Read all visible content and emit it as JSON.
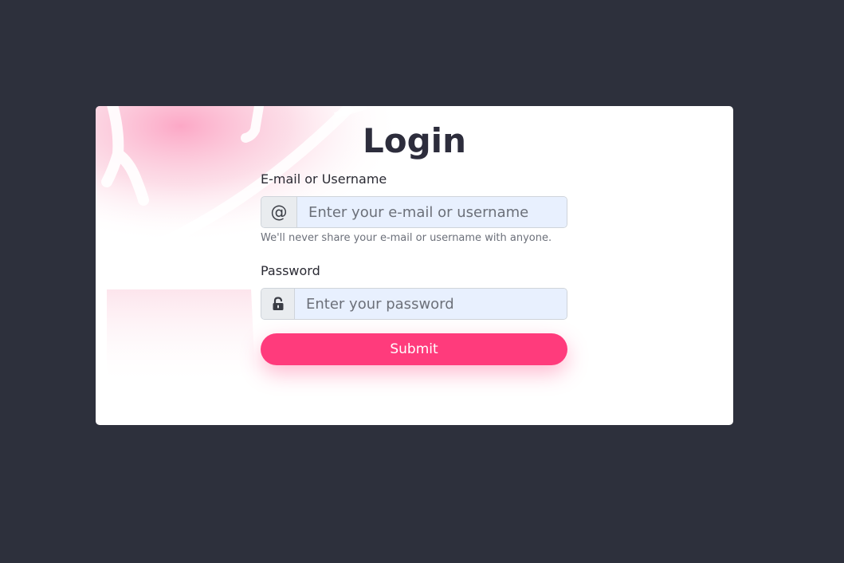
{
  "login": {
    "title": "Login",
    "email": {
      "label": "E-mail or Username",
      "icon": "at-icon",
      "icon_glyph": "@",
      "placeholder": "Enter your e-mail or username",
      "value": "",
      "help": "We'll never share your e-mail or username with anyone."
    },
    "password": {
      "label": "Password",
      "icon": "unlock-icon",
      "placeholder": "Enter your password",
      "value": ""
    },
    "submit_label": "Submit"
  },
  "colors": {
    "background": "#2d303c",
    "card": "#ffffff",
    "accent": "#ff3b7c",
    "input_fill": "#e8f0fe",
    "title": "#2d2d3c"
  }
}
